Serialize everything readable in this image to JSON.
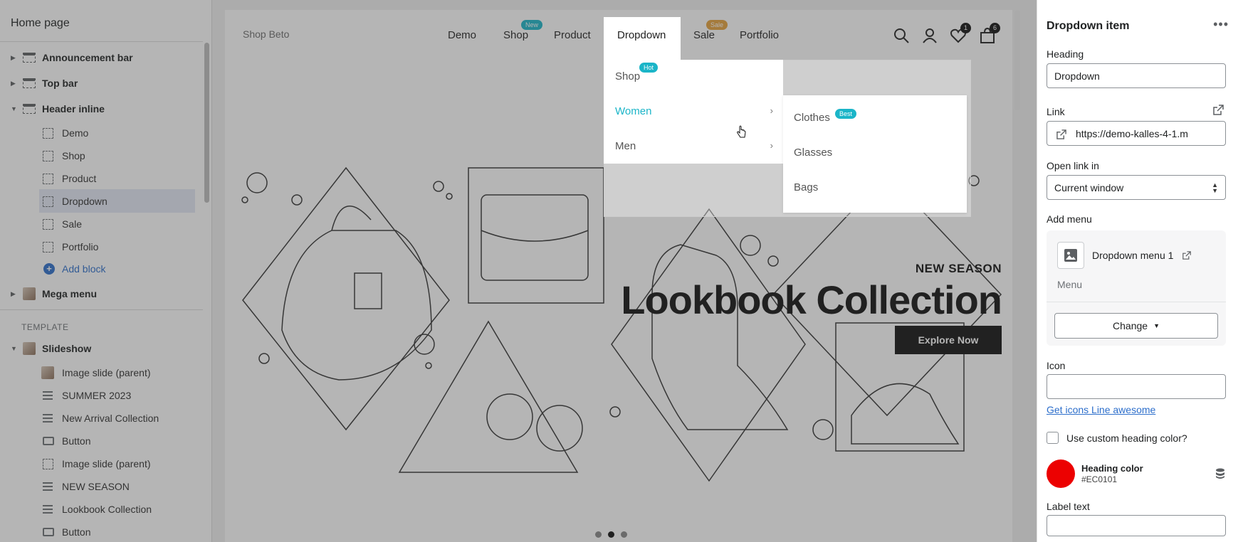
{
  "sidebar": {
    "title": "Home page",
    "sections": [
      {
        "label": "Announcement bar"
      },
      {
        "label": "Top bar"
      },
      {
        "label": "Header inline"
      }
    ],
    "header_blocks": [
      {
        "label": "Demo"
      },
      {
        "label": "Shop"
      },
      {
        "label": "Product"
      },
      {
        "label": "Dropdown"
      },
      {
        "label": "Sale"
      },
      {
        "label": "Portfolio"
      }
    ],
    "add_block": "Add block",
    "mega_menu": "Mega menu",
    "template_heading": "TEMPLATE",
    "slideshow": "Slideshow",
    "slideshow_blocks": [
      {
        "label": "Image slide (parent)"
      },
      {
        "label": "SUMMER 2023"
      },
      {
        "label": "New Arrival Collection"
      },
      {
        "label": "Button"
      },
      {
        "label": "Image slide (parent)"
      },
      {
        "label": "NEW SEASON"
      },
      {
        "label": "Lookbook Collection"
      },
      {
        "label": "Button"
      }
    ]
  },
  "preview": {
    "shop_name": "Shop Beto",
    "nav": [
      {
        "label": "Demo",
        "badge": ""
      },
      {
        "label": "Shop",
        "badge": "New"
      },
      {
        "label": "Product",
        "badge": ""
      },
      {
        "label": "Dropdown",
        "badge": ""
      },
      {
        "label": "Sale",
        "badge": "Sale"
      },
      {
        "label": "Portfolio",
        "badge": ""
      }
    ],
    "wishlist_count": "1",
    "cart_count": "6",
    "dropdown": {
      "items": [
        {
          "label": "Shop",
          "badge": "Hot"
        },
        {
          "label": "Women"
        },
        {
          "label": "Men"
        }
      ],
      "submenu": [
        {
          "label": "Clothes",
          "badge": "Best"
        },
        {
          "label": "Glasses"
        },
        {
          "label": "Bags"
        }
      ]
    },
    "hero": {
      "kicker": "NEW SEASON",
      "title": "Lookbook Collection",
      "button": "Explore Now"
    }
  },
  "panel": {
    "title": "Dropdown item",
    "heading_label": "Heading",
    "heading_value": "Dropdown",
    "link_label": "Link",
    "link_value": "https://demo-kalles-4-1.m",
    "open_link_label": "Open link in",
    "open_link_value": "Current window",
    "add_menu_label": "Add menu",
    "menu_name": "Dropdown menu 1",
    "menu_sub": "Menu",
    "change_button": "Change",
    "icon_label": "Icon",
    "icon_value": "",
    "icon_link": "Get icons Line awesome",
    "custom_color_label": "Use custom heading color?",
    "heading_color_label": "Heading color",
    "heading_color_value": "#EC0101",
    "label_text_label": "Label text"
  },
  "colors": {
    "accent_teal": "#1bb5c8",
    "badge_sale": "#e6a23c",
    "heading_color": "#EC0101",
    "link_blue": "#2c6ecb"
  }
}
